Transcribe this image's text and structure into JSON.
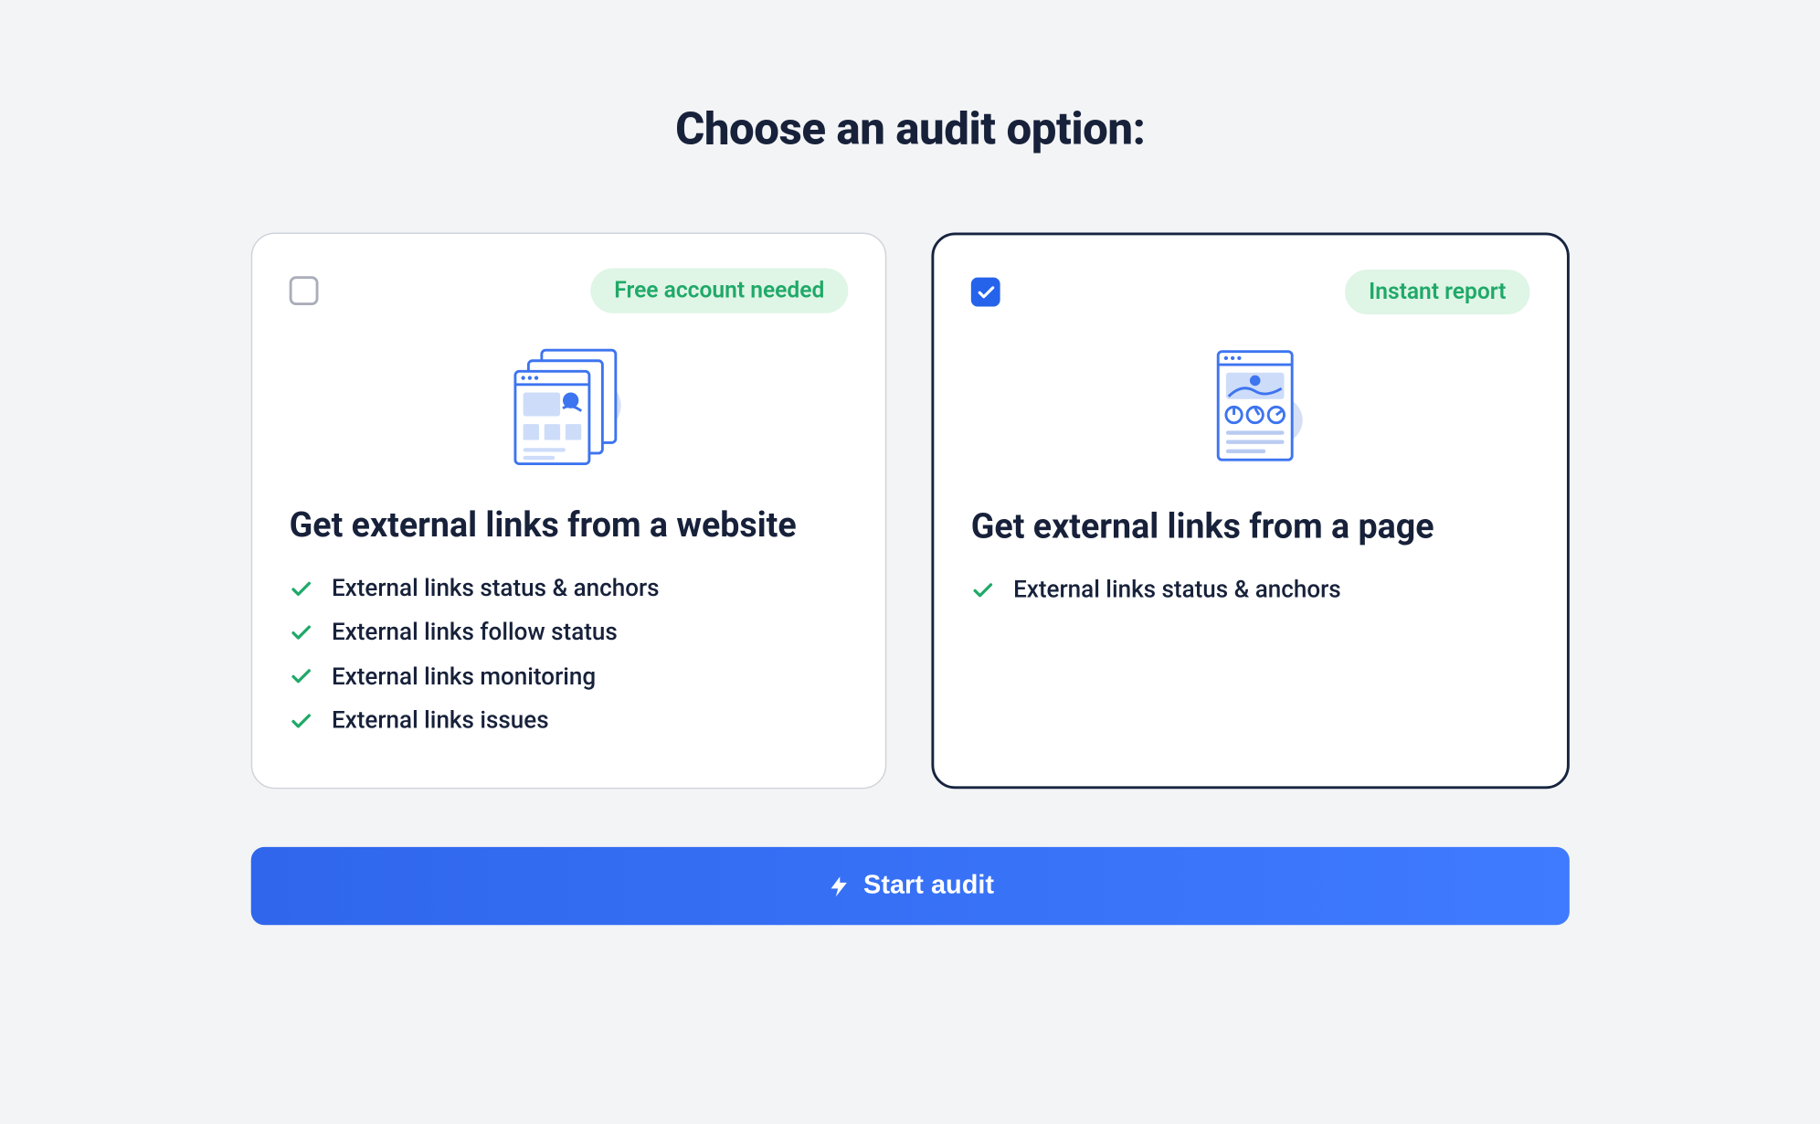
{
  "heading": "Choose an audit option:",
  "options": [
    {
      "selected": false,
      "badge": "Free account needed",
      "title": "Get external links from a website",
      "features": [
        "External links status & anchors",
        "External links follow status",
        "External links monitoring",
        "External links issues"
      ]
    },
    {
      "selected": true,
      "badge": "Instant report",
      "title": "Get external links from a page",
      "features": [
        "External links status & anchors"
      ]
    }
  ],
  "cta_label": "Start audit"
}
